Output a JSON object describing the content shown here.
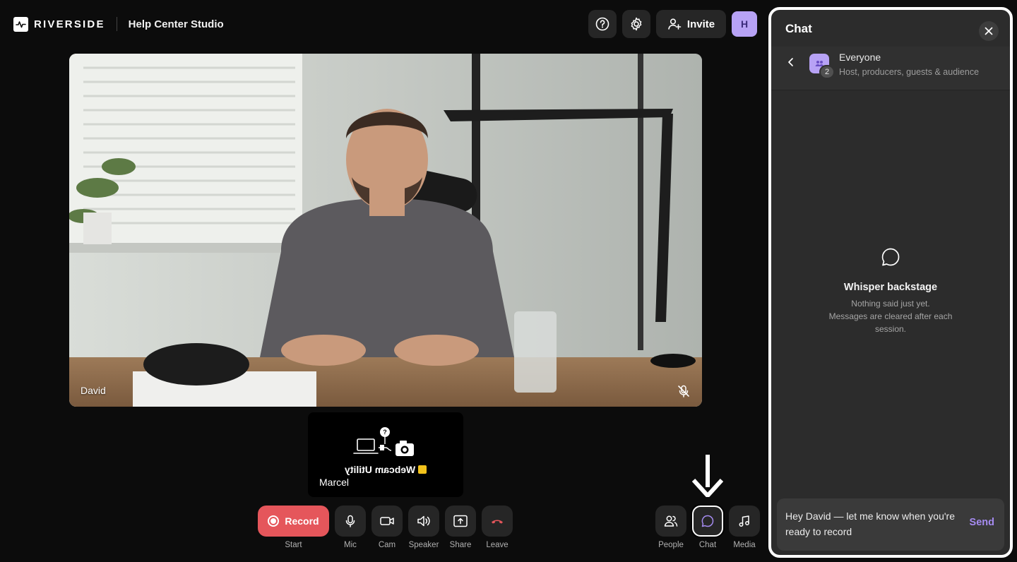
{
  "header": {
    "brand": "RIVERSIDE",
    "studio_name": "Help Center Studio",
    "invite_label": "Invite",
    "avatar_initial": "H"
  },
  "stage": {
    "main_participant": "David",
    "second_participant": "Marcel",
    "second_tile_caption": "Webcam Utility"
  },
  "controls": {
    "record_label": "Record",
    "record_sublabel": "Start",
    "mic_label": "Mic",
    "cam_label": "Cam",
    "speaker_label": "Speaker",
    "share_label": "Share",
    "leave_label": "Leave",
    "people_label": "People",
    "chat_label": "Chat",
    "media_label": "Media"
  },
  "chat": {
    "title": "Chat",
    "recipient_name": "Everyone",
    "recipient_count": "2",
    "recipient_desc": "Host, producers, guests & audience",
    "empty_title": "Whisper backstage",
    "empty_line1": "Nothing said just yet.",
    "empty_line2": "Messages are cleared after each session.",
    "draft_message": "Hey David — let me know when you're ready to record",
    "send_label": "Send"
  },
  "colors": {
    "accent": "#a58bf0",
    "record": "#e5565b",
    "leave": "#e5565b",
    "avatar": "#b7a2f5"
  },
  "icons": [
    "help-icon",
    "gear-icon",
    "add-user-icon",
    "mic-off-icon",
    "mic-icon",
    "camera-icon",
    "speaker-icon",
    "share-screen-icon",
    "phone-hangup-icon",
    "people-icon",
    "chat-bubble-icon",
    "music-note-icon",
    "close-icon",
    "chevron-left-icon",
    "group-icon",
    "arrow-down-icon"
  ]
}
